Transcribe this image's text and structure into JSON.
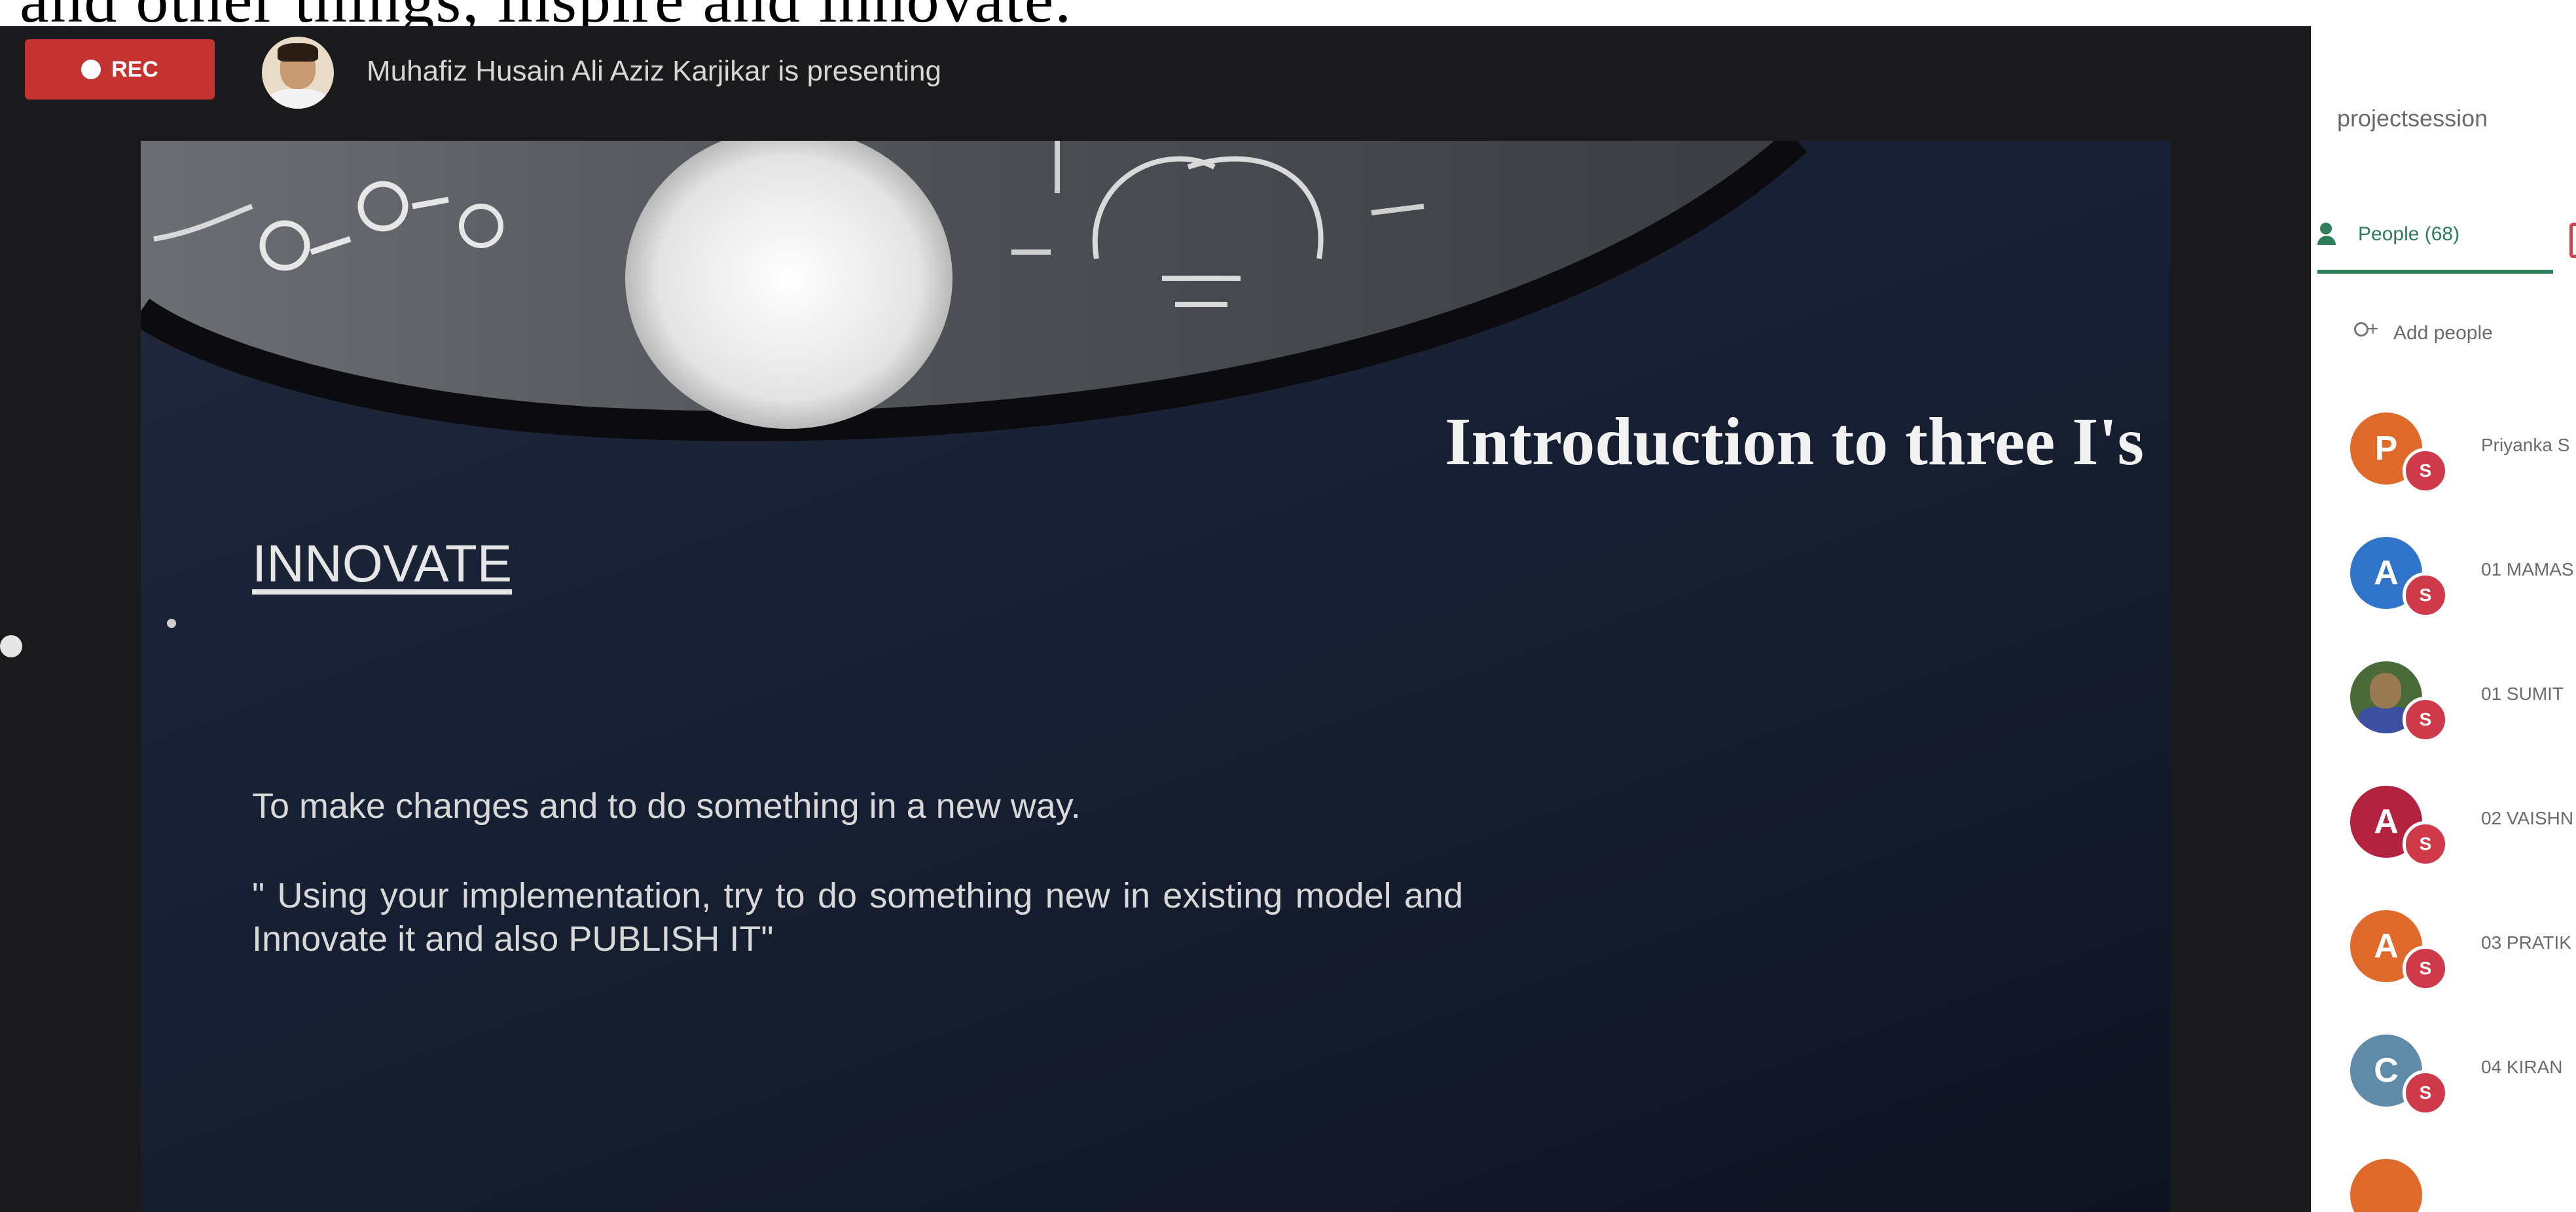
{
  "caption": {
    "text": "and other things, inspire and innovate."
  },
  "call": {
    "rec_label": "REC",
    "presenter_text": "Muhafiz Husain Ali Aziz Karjikar is presenting"
  },
  "slide": {
    "title": "Introduction to three I's",
    "heading": "INNOVATE",
    "body": "To make changes and to do something in a new way.",
    "quote": "\" Using your implementation, try to do something new in existing model and Innovate it and also PUBLISH IT\""
  },
  "panel": {
    "meeting_name": "projectsession",
    "people_tab_label": "People (68)",
    "add_people_label": "Add people",
    "participants": [
      {
        "initial": "P",
        "color": "#e06a2c",
        "name": "Priyanka S",
        "badge": "S"
      },
      {
        "initial": "A",
        "color": "#2f74c9",
        "name": "01 MAMAS",
        "badge": "S"
      },
      {
        "initial": "",
        "color": "#4a6a3a",
        "name": "01 SUMIT",
        "badge": "S",
        "photo": true
      },
      {
        "initial": "A",
        "color": "#b3233f",
        "name": "02 VAISHN",
        "badge": "S"
      },
      {
        "initial": "A",
        "color": "#e06a2c",
        "name": "03 PRATIK",
        "badge": "S"
      },
      {
        "initial": "C",
        "color": "#5f8aa8",
        "name": "04 KIRAN",
        "badge": "S"
      },
      {
        "initial": "",
        "color": "#e06a2c",
        "name": "",
        "badge": ""
      }
    ]
  },
  "colors": {
    "rec": "#c4332f",
    "accent_green": "#2e7d5b",
    "badge_red": "#cf3a4a"
  }
}
